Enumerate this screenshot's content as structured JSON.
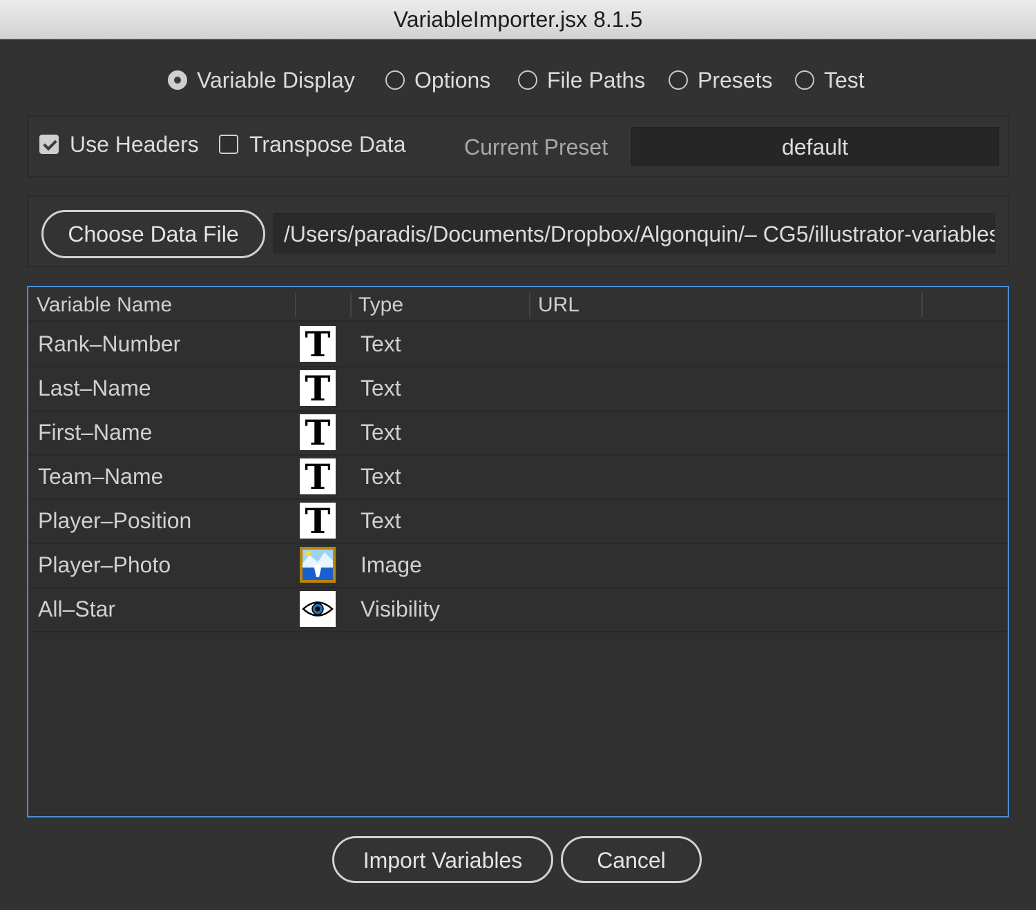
{
  "window": {
    "title": "VariableImporter.jsx 8.1.5"
  },
  "tabs": [
    {
      "label": "Variable Display",
      "selected": true
    },
    {
      "label": "Options",
      "selected": false
    },
    {
      "label": "File Paths",
      "selected": false
    },
    {
      "label": "Presets",
      "selected": false
    },
    {
      "label": "Test",
      "selected": false
    }
  ],
  "options": {
    "use_headers": {
      "label": "Use Headers",
      "checked": true
    },
    "transpose_data": {
      "label": "Transpose Data",
      "checked": false
    },
    "current_preset_label": "Current Preset",
    "current_preset_value": "default"
  },
  "data_file": {
    "button_label": "Choose Data File",
    "path": "/Users/paradis/Documents/Dropbox/Algonquin/– CG5/illustrator-variables"
  },
  "table": {
    "headers": {
      "name": "Variable Name",
      "type": "Type",
      "url": "URL"
    },
    "rows": [
      {
        "name": "Rank–Number",
        "icon": "text-type-icon",
        "type": "Text"
      },
      {
        "name": "Last–Name",
        "icon": "text-type-icon",
        "type": "Text"
      },
      {
        "name": "First–Name",
        "icon": "text-type-icon",
        "type": "Text"
      },
      {
        "name": "Team–Name",
        "icon": "text-type-icon",
        "type": "Text"
      },
      {
        "name": "Player–Position",
        "icon": "text-type-icon",
        "type": "Text"
      },
      {
        "name": "Player–Photo",
        "icon": "image-type-icon",
        "type": "Image"
      },
      {
        "name": "All–Star",
        "icon": "eye-icon",
        "type": "Visibility"
      }
    ]
  },
  "footer": {
    "import_label": "Import Variables",
    "cancel_label": "Cancel"
  },
  "colors": {
    "background": "#323232",
    "selection_border": "#4a8fd6",
    "titlebar": "#dedede"
  }
}
